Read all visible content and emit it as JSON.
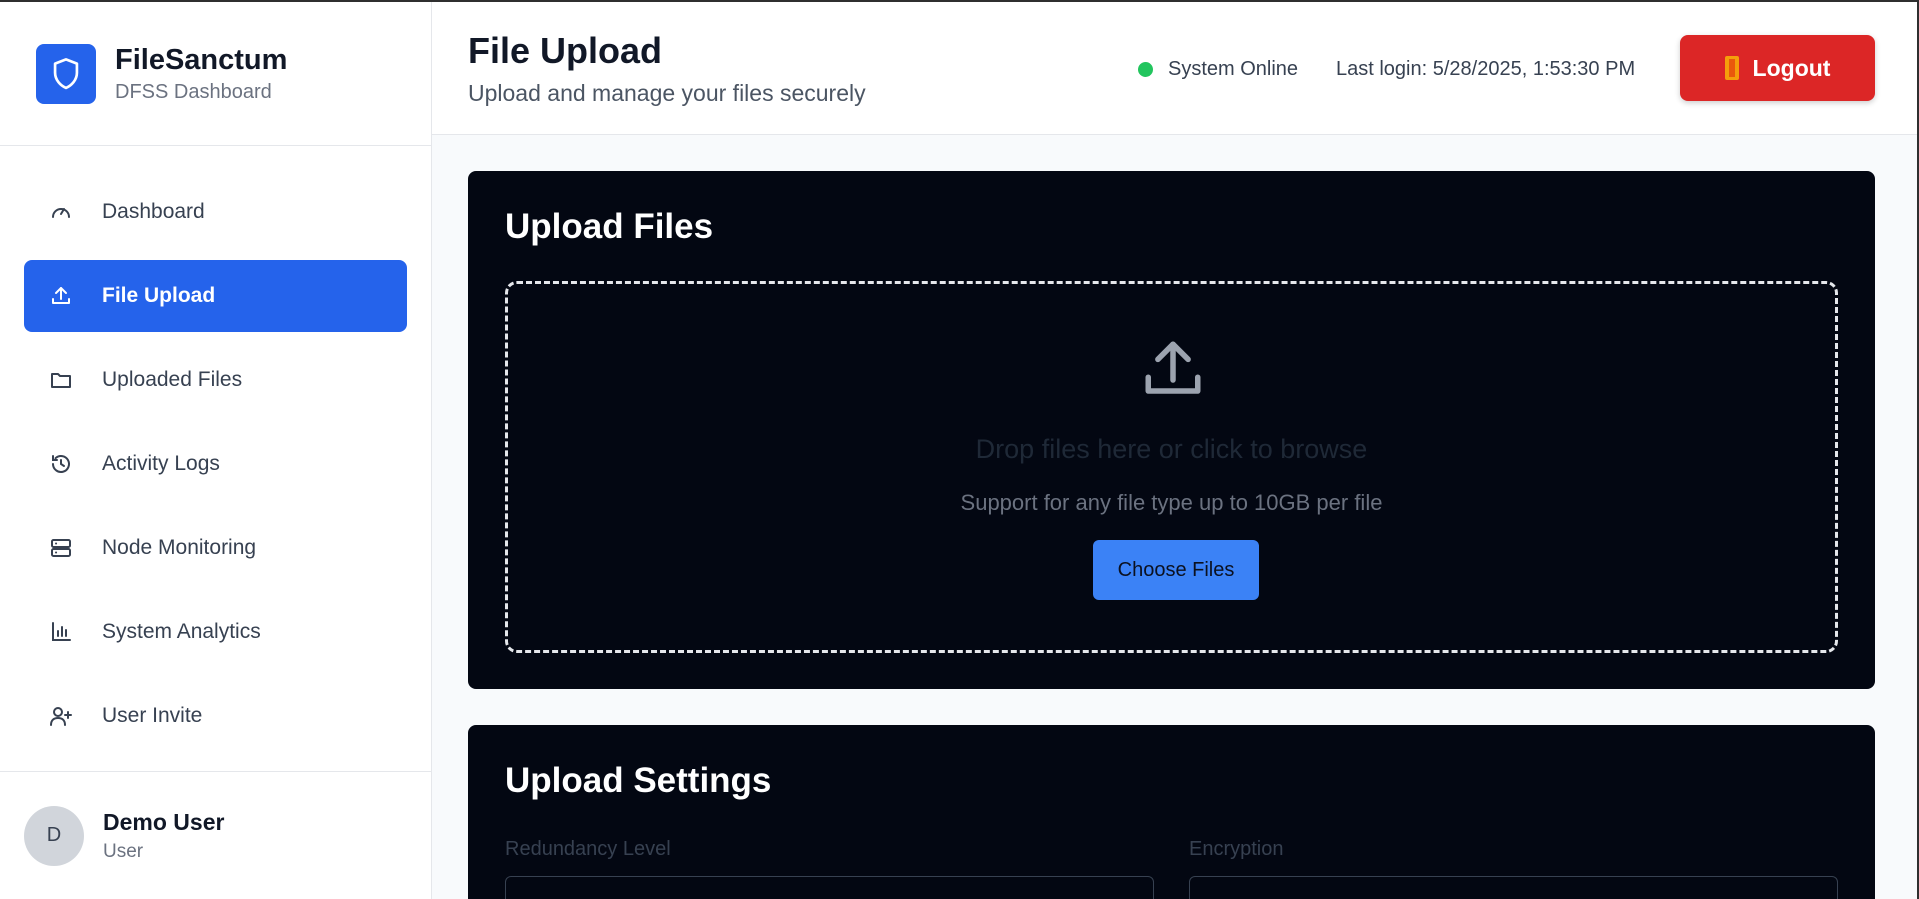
{
  "brand": {
    "name": "FileSanctum",
    "subtitle": "DFSS Dashboard"
  },
  "nav": {
    "items": [
      {
        "label": "Dashboard",
        "icon": "gauge-icon"
      },
      {
        "label": "File Upload",
        "icon": "upload-icon",
        "active": true
      },
      {
        "label": "Uploaded Files",
        "icon": "folder-icon"
      },
      {
        "label": "Activity Logs",
        "icon": "history-icon"
      },
      {
        "label": "Node Monitoring",
        "icon": "server-icon"
      },
      {
        "label": "System Analytics",
        "icon": "bar-chart-icon"
      },
      {
        "label": "User Invite",
        "icon": "user-plus-icon"
      }
    ]
  },
  "user": {
    "initial": "D",
    "name": "Demo User",
    "role": "User"
  },
  "header": {
    "title": "File Upload",
    "subtitle": "Upload and manage your files securely",
    "status": "System Online",
    "last_login": "Last login: 5/28/2025, 1:53:30 PM",
    "logout_label": "Logout"
  },
  "upload": {
    "title": "Upload Files",
    "drop_text": "Drop files here or click to browse",
    "support_text": "Support for any file type up to 10GB per file",
    "choose_label": "Choose Files"
  },
  "settings": {
    "title": "Upload Settings",
    "redundancy_label": "Redundancy Level",
    "encryption_label": "Encryption"
  },
  "colors": {
    "primary": "#2563eb",
    "danger": "#dc2626",
    "online": "#22c55e",
    "card_bg": "#030712"
  }
}
